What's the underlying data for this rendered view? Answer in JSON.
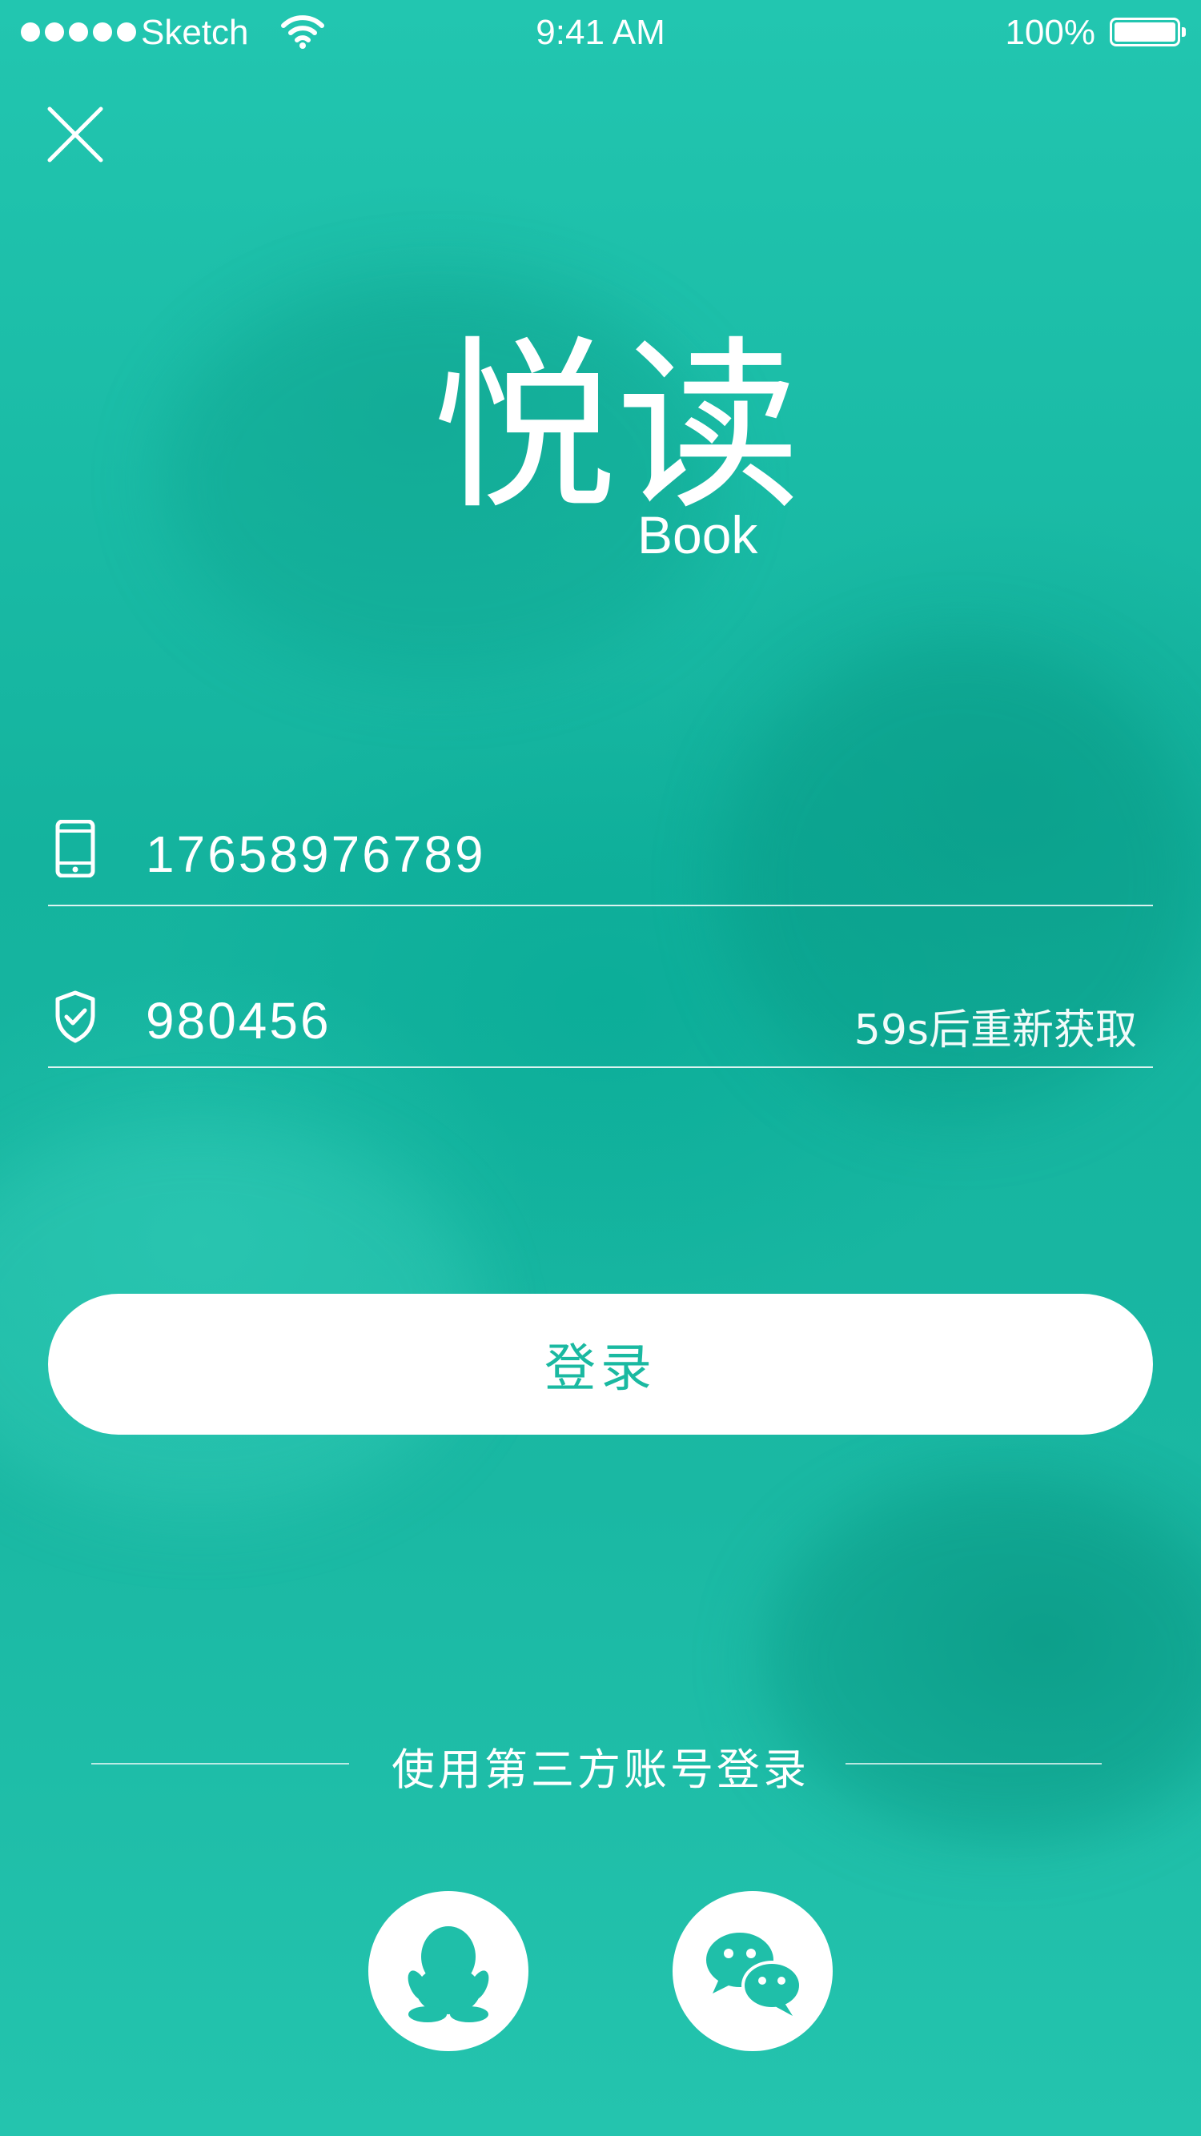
{
  "status_bar": {
    "carrier": "Sketch",
    "time": "9:41 AM",
    "battery": "100%"
  },
  "logo": {
    "cn": "悦读",
    "en": "Book"
  },
  "form": {
    "phone": "17658976789",
    "code": "980456",
    "resend_label": "59s后重新获取"
  },
  "login_button": "登录",
  "third_party": {
    "label": "使用第三方账号登录",
    "providers": [
      "qq-icon",
      "wechat-icon"
    ]
  },
  "colors": {
    "accent": "#1ab9a1",
    "background": "#1fbfa9"
  }
}
